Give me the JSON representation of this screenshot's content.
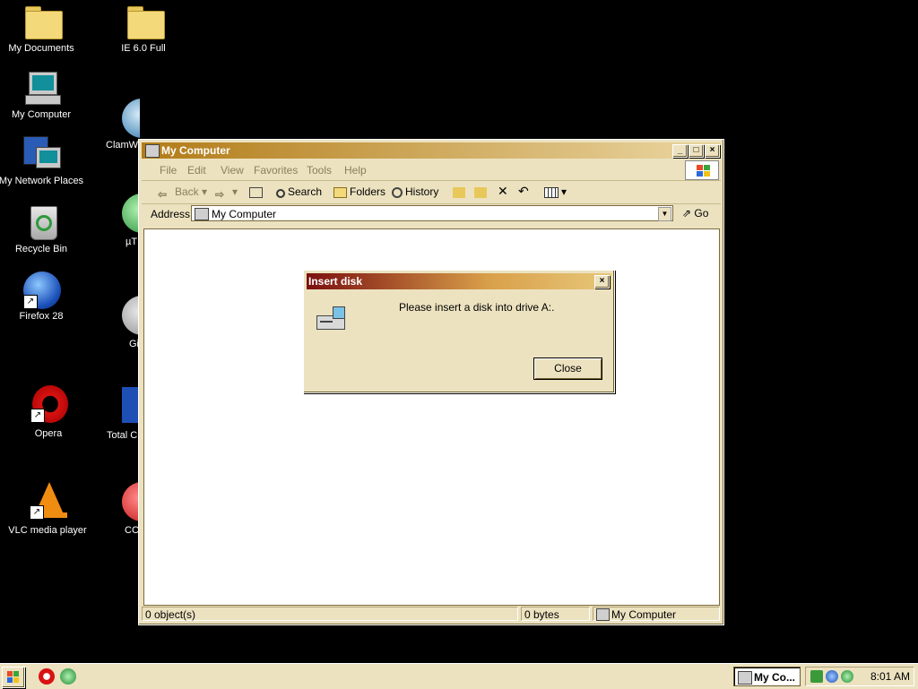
{
  "desktop": {
    "icons": [
      {
        "label": "My Documents"
      },
      {
        "label": "IE 6.0 Full"
      },
      {
        "label": "My Computer"
      },
      {
        "label": "ClamWi"
      },
      {
        "label": "My Network Places"
      },
      {
        "label": "µT"
      },
      {
        "label": "Recycle Bin"
      },
      {
        "label": "Firefox 28"
      },
      {
        "label": "Gi"
      },
      {
        "label": "Opera"
      },
      {
        "label": "Total C"
      },
      {
        "label": "VLC media player"
      },
      {
        "label": "CC"
      }
    ]
  },
  "window": {
    "title": "My Computer",
    "controls": {
      "minimize": "_",
      "maximize": "□",
      "close": "×"
    },
    "menu": [
      "File",
      "Edit",
      "View",
      "Favorites",
      "Tools",
      "Help"
    ],
    "toolbar": {
      "back": "Back",
      "search": "Search",
      "folders": "Folders",
      "history": "History"
    },
    "address": {
      "label": "Address",
      "value": "My Computer",
      "go": "Go"
    },
    "status": {
      "objects": "0 object(s)",
      "size": "0 bytes",
      "zone": "My Computer"
    }
  },
  "dialog": {
    "title": "Insert disk",
    "message": "Please insert a disk into drive A:.",
    "close_button": "Close",
    "close_glyph": "×"
  },
  "taskbar": {
    "task_label": "My Co...",
    "clock": "8:01 AM"
  },
  "colors": {
    "desktop": "#000000",
    "window_face": "#ece2c0",
    "title_active": "#b27c18",
    "dialog_title": "#7b0f0f"
  }
}
